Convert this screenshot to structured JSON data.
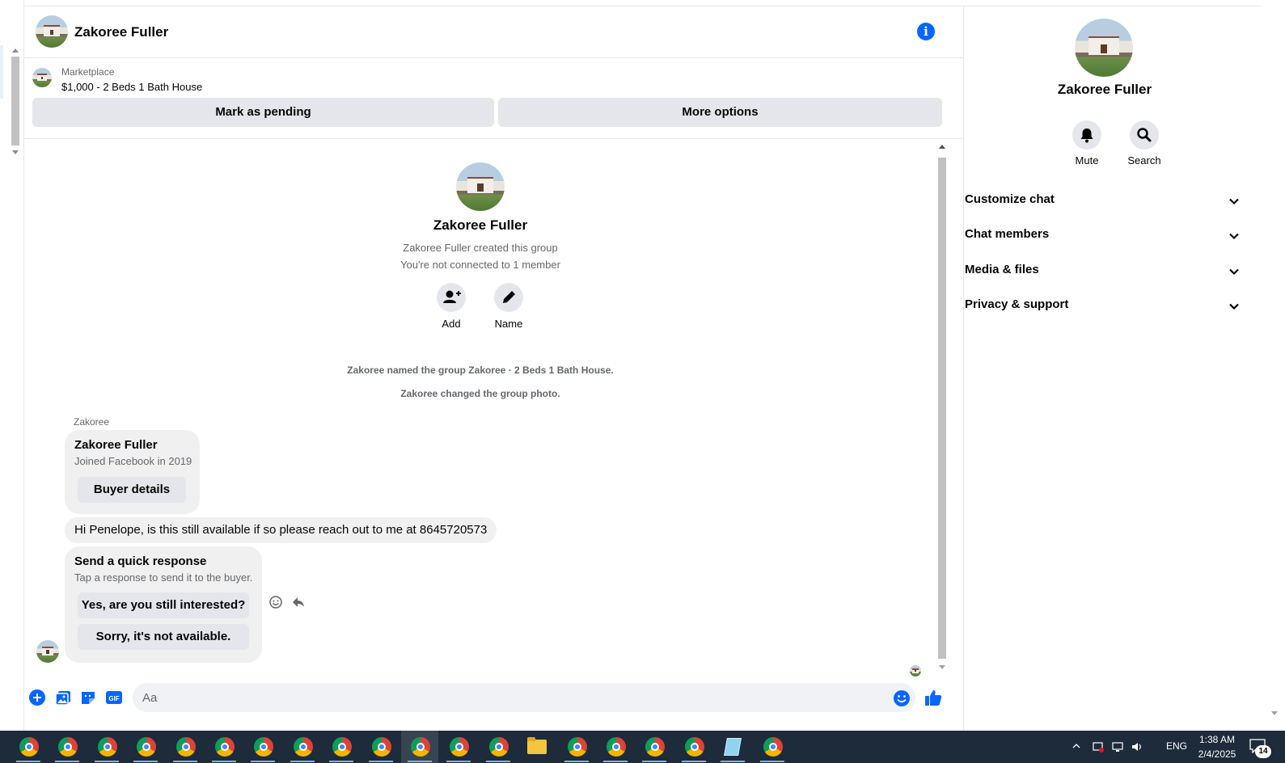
{
  "header": {
    "contact_name": "Zakoree Fuller",
    "info_icon": "info-icon"
  },
  "marketplace": {
    "label": "Marketplace",
    "title": "$1,000 - 2 Beds 1 Bath House",
    "mark_pending_label": "Mark as pending",
    "more_options_label": "More options"
  },
  "conversation": {
    "group_name": "Zakoree Fuller",
    "created_text": "Zakoree Fuller created this group",
    "not_connected_text": "You're not connected to 1 member",
    "add_label": "Add",
    "name_label": "Name",
    "system_messages": [
      "Zakoree named the group Zakoree · 2 Beds 1 Bath House.",
      "Zakoree changed the group photo."
    ],
    "sender": "Zakoree",
    "profile_card": {
      "name": "Zakoree Fuller",
      "joined": "Joined Facebook in 2019",
      "button": "Buyer details"
    },
    "message": "Hi Penelope, is this still available if so please reach out to me at 8645720573",
    "quick_response": {
      "title": "Send a quick response",
      "subtitle": "Tap a response to send it to the buyer.",
      "options": [
        "Yes, are you still interested?",
        "Sorry, it's not available."
      ]
    }
  },
  "composer": {
    "placeholder": "Aa",
    "icons": [
      "plus-icon",
      "photo-icon",
      "sticker-icon",
      "gif-icon",
      "emoji-icon",
      "thumbs-up-icon"
    ]
  },
  "panel": {
    "name": "Zakoree Fuller",
    "mute_label": "Mute",
    "search_label": "Search",
    "sections": [
      "Customize chat",
      "Chat members",
      "Media & files",
      "Privacy & support"
    ]
  },
  "taskbar": {
    "language": "ENG",
    "time": "1:38 AM",
    "date": "2/4/2025",
    "notification_count": "14"
  },
  "colors": {
    "accent": "#0866ff",
    "bubble": "#f0f0f0",
    "button": "#e4e6eb",
    "taskbar": "#1d2b3a"
  }
}
